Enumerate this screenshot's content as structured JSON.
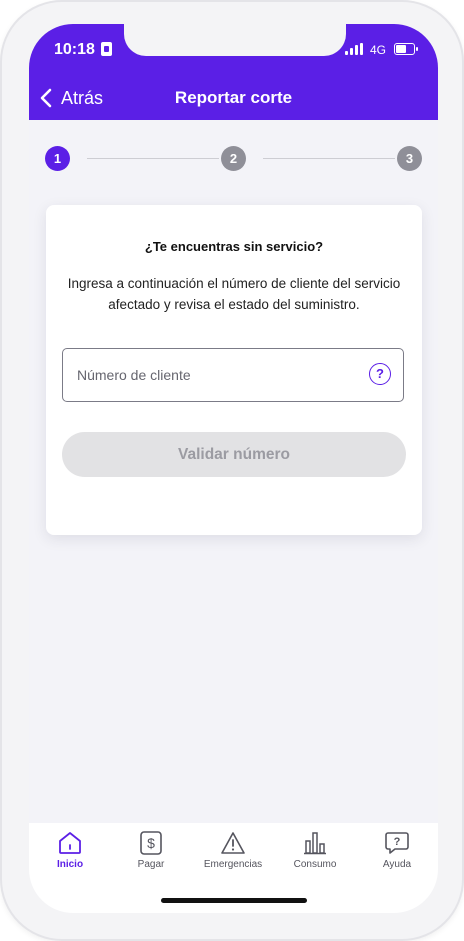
{
  "status_bar": {
    "time": "10:18",
    "network": "4G"
  },
  "header": {
    "back_label": "Atrás",
    "title": "Reportar corte"
  },
  "stepper": {
    "steps": [
      "1",
      "2",
      "3"
    ],
    "active_step": 1
  },
  "card": {
    "title": "¿Te encuentras sin servicio?",
    "description": "Ingresa a continuación el número de cliente del servicio afectado y revisa el estado del suministro.",
    "input_placeholder": "Número de cliente",
    "input_value": "",
    "help_symbol": "?",
    "validate_label": "Validar número"
  },
  "tabbar": {
    "items": [
      {
        "label": "Inicio",
        "icon": "home-icon",
        "active": true
      },
      {
        "label": "Pagar",
        "icon": "dollar-icon",
        "active": false
      },
      {
        "label": "Emergencias",
        "icon": "warning-icon",
        "active": false
      },
      {
        "label": "Consumo",
        "icon": "bar-chart-icon",
        "active": false
      },
      {
        "label": "Ayuda",
        "icon": "help-chat-icon",
        "active": false
      }
    ]
  },
  "colors": {
    "accent": "#5b1fe6",
    "inactive_step": "#8f8f98",
    "disabled_button": "#e2e2e4"
  }
}
